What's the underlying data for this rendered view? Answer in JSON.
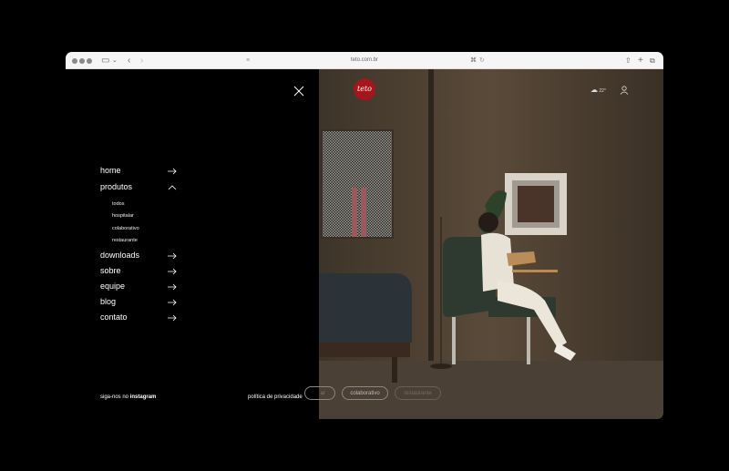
{
  "browser": {
    "url": "teto.com.br"
  },
  "menu": {
    "items": [
      {
        "label": "home"
      },
      {
        "label": "produtos"
      },
      {
        "label": "downloads"
      },
      {
        "label": "sobre"
      },
      {
        "label": "equipe"
      },
      {
        "label": "blog"
      },
      {
        "label": "contato"
      }
    ],
    "sub_items": [
      {
        "label": "todos"
      },
      {
        "label": "hospitalar"
      },
      {
        "label": "colaborativo"
      },
      {
        "label": "restaurante"
      }
    ],
    "footer": {
      "follow_prefix": "siga-nos no ",
      "follow_link": "instagram",
      "privacy": "política de privacidade"
    }
  },
  "header": {
    "logo": "teto",
    "weather": "22°"
  },
  "chips": [
    "ar",
    "colaborativo",
    "restaurante"
  ]
}
